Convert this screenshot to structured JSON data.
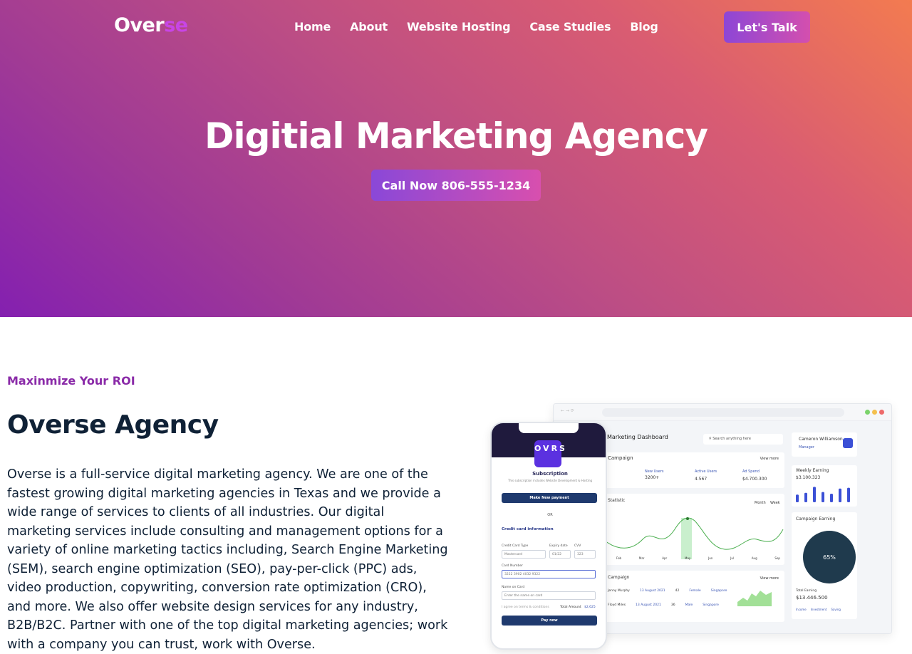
{
  "header": {
    "logo_main": "Over",
    "logo_accent": "se",
    "nav": [
      "Home",
      "About",
      "Website Hosting",
      "Case Studies",
      "Blog"
    ],
    "cta": "Let's Talk"
  },
  "hero": {
    "title": "Digitial Marketing Agency",
    "call_button": "Call Now 806-555-1234"
  },
  "about": {
    "eyebrow": "Maxinmize Your ROI",
    "title": "Overse Agency",
    "body": "Overse is a full-service digital marketing agency. We are one of the fastest growing digital marketing agencies in Texas and we provide a wide range of services to clients of all industries. Our digital marketing services include consulting and management options for a variety of online marketing tactics including, Search Engine Marketing (SEM), search engine optimization (SEO), pay-per-click (PPC) ads, video production, copywriting, conversion rate optimization (CRO), and more. We also offer website design services for any industry, B2B/B2C. Partner with one of the top digital marketing agencies; work with a company you can trust, work with Overse."
  },
  "dashboard": {
    "title": "Marketing Dashboard",
    "search_placeholder": "Search anything here",
    "user_name": "Cameron Williamson",
    "user_role": "Manager",
    "campaign_label": "Campaign",
    "view_more": "View more",
    "stats": [
      {
        "label": "New Users",
        "value": "3200+"
      },
      {
        "label": "Active Users",
        "value": "4.567"
      },
      {
        "label": "Ad Spend",
        "value": "$4.700.300"
      }
    ],
    "statistic_label": "Statistic",
    "statistic_tabs": [
      "Month",
      "Week"
    ],
    "months": [
      "Feb",
      "Mar",
      "Apr",
      "May",
      "Jun",
      "Jul",
      "Aug",
      "Sep"
    ],
    "weekly_label": "Weekly Earning",
    "weekly_value": "$3.100.323",
    "weekly_bars": [
      0.45,
      0.55,
      0.9,
      0.6,
      0.5,
      0.8,
      0.85
    ],
    "campaign_earning_label": "Campaign Earning",
    "campaign_percent": "65%",
    "total_earning_label": "Total Earning",
    "total_earning_value": "$13.446.500",
    "legend": [
      "Income",
      "Investment",
      "Saving"
    ],
    "table_rows": [
      {
        "name": "Jenny Murphy",
        "date": "13 August 2021",
        "age": "42",
        "gender": "Female",
        "city": "Singapore"
      },
      {
        "name": "Floyd Miles",
        "date": "13 August 2021",
        "age": "36",
        "gender": "Male",
        "city": "Singapore"
      }
    ]
  },
  "phone": {
    "logo": "OVRS",
    "subscription": "Subscription",
    "sub_text": "This subscription includes Website Development & Hosting",
    "make_payment": "Make New payment",
    "or": "OR",
    "credit_card_info": "Credit card information",
    "card_type_label": "Credit Card Type",
    "card_type": "Mastercard",
    "expiry_label": "Expiry date",
    "expiry": "01/22",
    "cvv_label": "CVV",
    "cvv": "323",
    "card_number_label": "Card Number",
    "card_number": "3222 3902 4032 9322",
    "name_label": "Name on Card",
    "name_placeholder": "Enter the name on card",
    "agree": "I agree on terms & conditions",
    "total_label": "Total Amount",
    "total_value": "$2,625",
    "pay_now": "Pay now"
  },
  "colors": {
    "eyebrow": "#8a2aa8",
    "heading": "#0f2136",
    "logo_accent": "#c845e6",
    "button_gradient_start": "#8d46d6",
    "button_gradient_end": "#d44fae"
  }
}
